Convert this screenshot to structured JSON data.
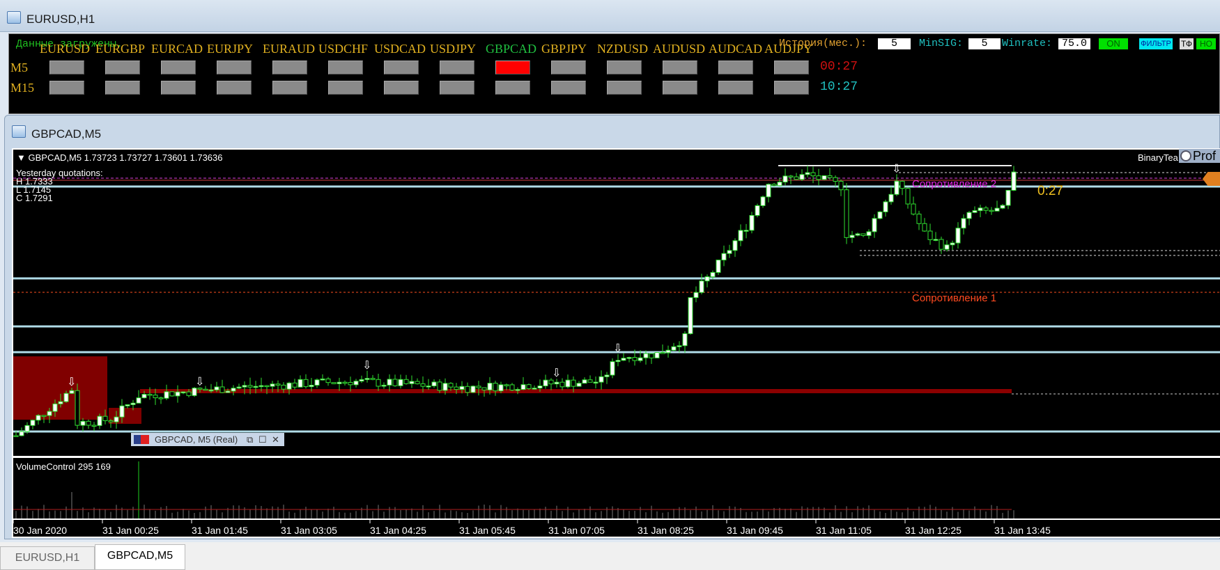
{
  "window1": {
    "title": "EURUSD,H1"
  },
  "panel": {
    "status": "Данные загружены.",
    "pairs": [
      "EURUSD",
      "EURGBP",
      "EURCAD",
      "EURJPY",
      "EURAUD",
      "USDCHF",
      "USDCAD",
      "USDJPY",
      "GBPCAD",
      "GBPJPY",
      "NZDUSD",
      "AUDUSD",
      "AUDCAD",
      "AUDJPY"
    ],
    "active_pair_index": 8,
    "rows": [
      {
        "label": "M5",
        "timer": "00:27",
        "timer_color": "#d01010"
      },
      {
        "label": "M15",
        "timer": "10:27",
        "timer_color": "#20c0c0"
      }
    ],
    "history_label": "История(мес.):",
    "history_value": "5",
    "minsig_label": "MinSIG:",
    "minsig_value": "5",
    "winrate_label": "Winrate:",
    "winrate_value": "75.0",
    "on_label": "ON",
    "filter_label": "ФИЛЬТР",
    "tf_label": "ТФ",
    "no_label": "НО"
  },
  "window2": {
    "title": "GBPCAD,M5"
  },
  "chart": {
    "header": "GBPCAD,M5  1.73723 1.73727 1.73601 1.73636",
    "yesterday_title": "Yesterday quotations:",
    "yesterday_h": "H 1.7333",
    "yesterday_l": "L 1.7145",
    "yesterday_c": "C 1.7291",
    "resistance1": "Сопротивление 1",
    "resistance2": "Сопротивление 2",
    "countdown": "0:27",
    "binary_label": "BinaryTea",
    "prof_label": "Prof",
    "popup_title": "GBPCAD, M5 (Real)",
    "volume_label": "VolumeControl 295 169",
    "time_labels": [
      "30 Jan 2020",
      "31 Jan 00:25",
      "31 Jan 01:45",
      "31 Jan 03:05",
      "31 Jan 04:25",
      "31 Jan 05:45",
      "31 Jan 07:05",
      "31 Jan 08:25",
      "31 Jan 09:45",
      "31 Jan 11:05",
      "31 Jan 12:25",
      "31 Jan 13:45"
    ]
  },
  "chart_data": {
    "type": "candlestick",
    "symbol": "GBPCAD",
    "timeframe": "M5",
    "price_waypoints": [
      [
        0,
        1.7202
      ],
      [
        10,
        1.7231
      ],
      [
        11,
        1.721
      ],
      [
        17,
        1.7212
      ],
      [
        22,
        1.7227
      ],
      [
        39,
        1.7232
      ],
      [
        60,
        1.7236
      ],
      [
        81,
        1.7232
      ],
      [
        105,
        1.7236
      ],
      [
        108,
        1.7251
      ],
      [
        115,
        1.7253
      ],
      [
        120,
        1.7263
      ],
      [
        121,
        1.7287
      ],
      [
        126,
        1.7309
      ],
      [
        131,
        1.7333
      ],
      [
        135,
        1.736
      ],
      [
        142,
        1.7365
      ],
      [
        148,
        1.7358
      ],
      [
        149,
        1.7328
      ],
      [
        152,
        1.7326
      ],
      [
        158,
        1.736
      ],
      [
        163,
        1.7328
      ],
      [
        167,
        1.7319
      ],
      [
        171,
        1.7341
      ],
      [
        177,
        1.7343
      ],
      [
        179,
        1.7364
      ]
    ],
    "signal_bars": [
      10,
      33,
      63,
      97,
      108,
      158
    ]
  },
  "tabs": [
    {
      "label": "EURUSD,H1",
      "active": false
    },
    {
      "label": "GBPCAD,M5",
      "active": true
    }
  ]
}
